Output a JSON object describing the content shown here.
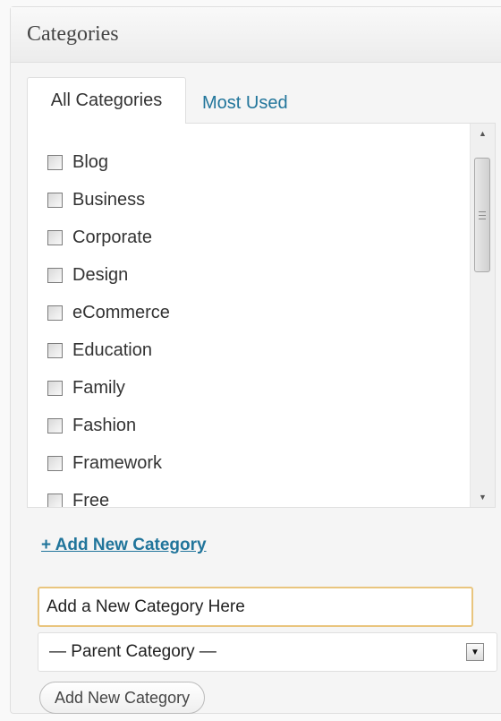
{
  "panel": {
    "title": "Categories"
  },
  "tabs": {
    "active": "All Categories",
    "inactive": "Most Used"
  },
  "categories": [
    {
      "label": "Blog",
      "checked": false
    },
    {
      "label": "Business",
      "checked": false
    },
    {
      "label": "Corporate",
      "checked": false
    },
    {
      "label": "Design",
      "checked": false
    },
    {
      "label": "eCommerce",
      "checked": false
    },
    {
      "label": "Education",
      "checked": false
    },
    {
      "label": "Family",
      "checked": false
    },
    {
      "label": "Fashion",
      "checked": false
    },
    {
      "label": "Framework",
      "checked": false
    },
    {
      "label": "Free",
      "checked": false
    }
  ],
  "add_new": {
    "link_label": "+ Add New Category",
    "input_value": "Add a New Category Here",
    "parent_selected": "— Parent Category —",
    "button_label": "Add New Category"
  },
  "colors": {
    "link": "#21759b",
    "input_focus_border": "#e9c57e"
  }
}
